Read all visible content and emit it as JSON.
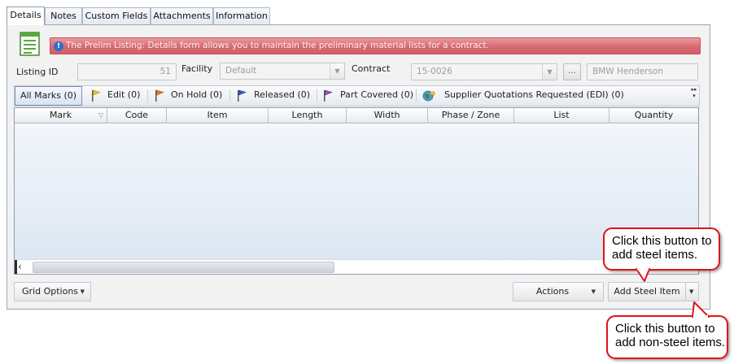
{
  "tabs": [
    {
      "label": "Details",
      "active": true
    },
    {
      "label": "Notes",
      "active": false
    },
    {
      "label": "Custom Fields",
      "active": false
    },
    {
      "label": "Attachments",
      "active": false
    },
    {
      "label": "Information",
      "active": false
    }
  ],
  "banner": {
    "icon": "info-icon",
    "text": "The Prelim Listing: Details form allows you to maintain the preliminary material lists for a contract.",
    "color": "#d86970"
  },
  "fields": {
    "listing_id": {
      "label": "Listing ID",
      "value": "51"
    },
    "facility": {
      "label": "Facility",
      "value": "Default"
    },
    "contract": {
      "label": "Contract",
      "value": "15-0026",
      "description": "BMW Henderson"
    },
    "ellipsis_label": "..."
  },
  "filters": {
    "all": "All Marks (0)",
    "items": [
      {
        "label": "Edit (0)",
        "icon": "yellow-flag-icon",
        "color": "#e6c21a"
      },
      {
        "label": "On Hold (0)",
        "icon": "orange-flag-icon",
        "color": "#e8782a"
      },
      {
        "label": "Released (0)",
        "icon": "blue-flag-icon",
        "color": "#2e5fc7"
      },
      {
        "label": "Part Covered (0)",
        "icon": "purple-flag-icon",
        "color": "#8c56c4"
      },
      {
        "label": "Supplier Quotations Requested (EDI) (0)",
        "icon": "globe-icon",
        "color": "#3f8a3c"
      }
    ]
  },
  "grid": {
    "columns": [
      "Mark",
      "Code",
      "Item",
      "Length",
      "Width",
      "Phase / Zone",
      "List",
      "Quantity"
    ],
    "rows": []
  },
  "buttons": {
    "grid_options": "Grid Options",
    "actions": "Actions",
    "add_steel_item": "Add Steel Item"
  },
  "callouts": {
    "steel": {
      "line1": "Click this button to",
      "line2": "add steel items."
    },
    "non_steel": {
      "line1": "Click this button to",
      "line2": "add non-steel items."
    },
    "border_color": "#e0141b"
  }
}
